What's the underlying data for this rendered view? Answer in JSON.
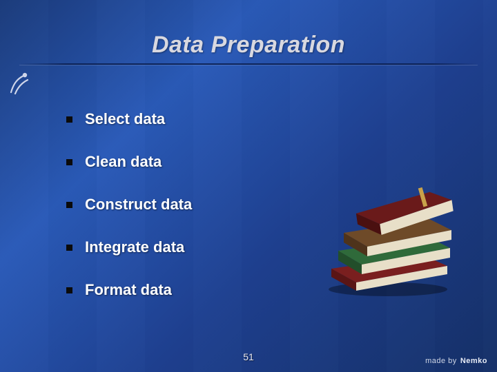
{
  "title": "Data Preparation",
  "bullets": [
    {
      "label": "Select data"
    },
    {
      "label": "Clean data"
    },
    {
      "label": "Construct data"
    },
    {
      "label": "Integrate data"
    },
    {
      "label": "Format data"
    }
  ],
  "page_number": "51",
  "footer": {
    "made_by": "made by",
    "brand": "Nemko"
  },
  "icons": {
    "bullet": "square-bullet-icon",
    "logo": "figure-logo-icon",
    "books": "books-stack-icon"
  }
}
